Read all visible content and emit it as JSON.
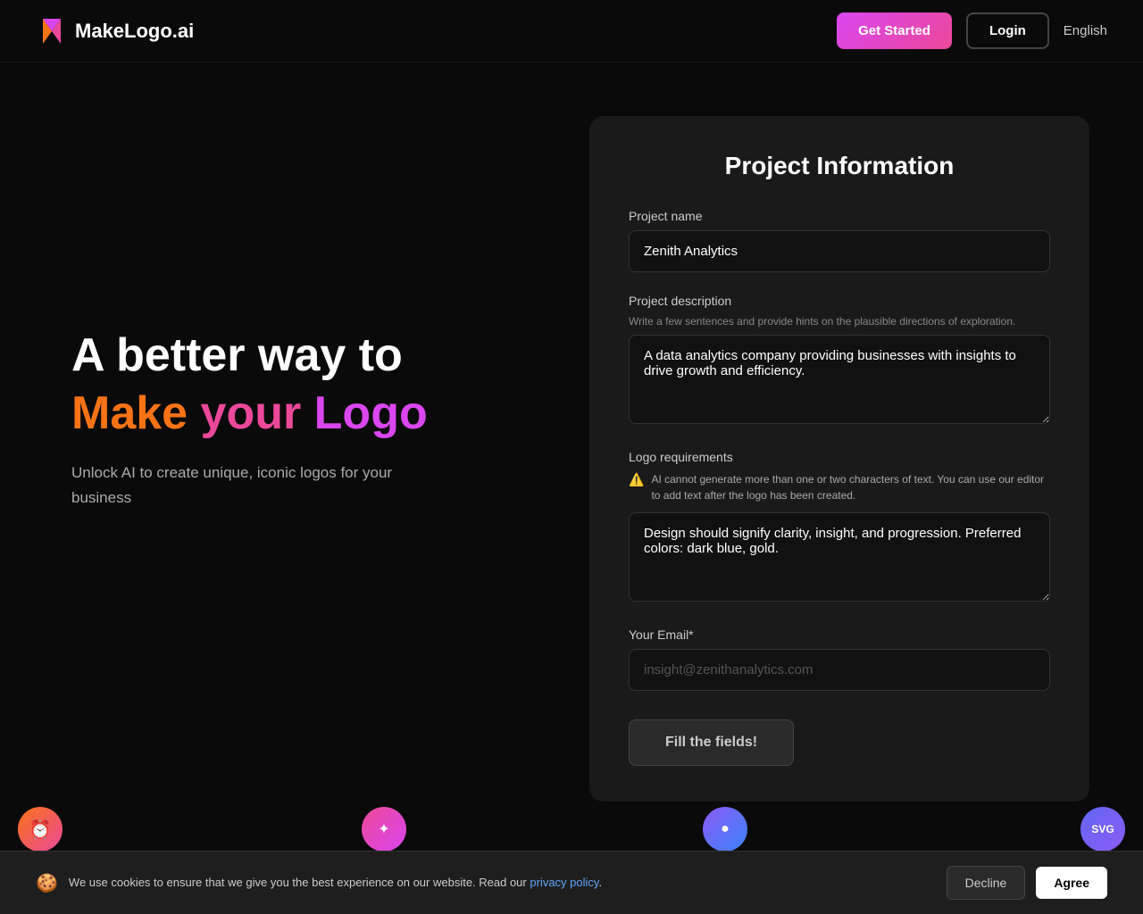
{
  "header": {
    "logo_text": "akeLogo.ai",
    "logo_m": "M",
    "get_started_label": "Get Started",
    "login_label": "Login",
    "language_label": "English"
  },
  "hero": {
    "line1": "A better way to",
    "make": "Make",
    "your": "your",
    "logo_word": "Logo",
    "description_line1": "Unlock AI to create unique, iconic logos for your",
    "description_line2": "business"
  },
  "form": {
    "title": "Project Information",
    "project_name_label": "Project name",
    "project_name_value": "Zenith Analytics",
    "project_description_label": "Project description",
    "project_description_hint": "Write a few sentences and provide hints on the plausible directions of exploration.",
    "project_description_value": "A data analytics company providing businesses with insights to drive growth and efficiency.",
    "logo_requirements_label": "Logo requirements",
    "warning_text": "AI cannot generate more than one or two characters of text. You can use our editor to add text after the logo has been created.",
    "logo_requirements_value": "Design should signify clarity, insight, and progression. Preferred colors: dark blue, gold.",
    "email_label": "Your Email*",
    "email_placeholder": "insight@zenithanalytics.com",
    "submit_label": "Fill the fields!"
  },
  "cookie": {
    "text": "We use cookies to ensure that we give you the best experience on our website. Read our",
    "link_text": "privacy policy",
    "decline_label": "Decline",
    "agree_label": "Agree"
  },
  "floating": {
    "clock_icon": "⏰",
    "star_icon": "✦",
    "circle_icon": "●",
    "svg_label": "SVG"
  }
}
